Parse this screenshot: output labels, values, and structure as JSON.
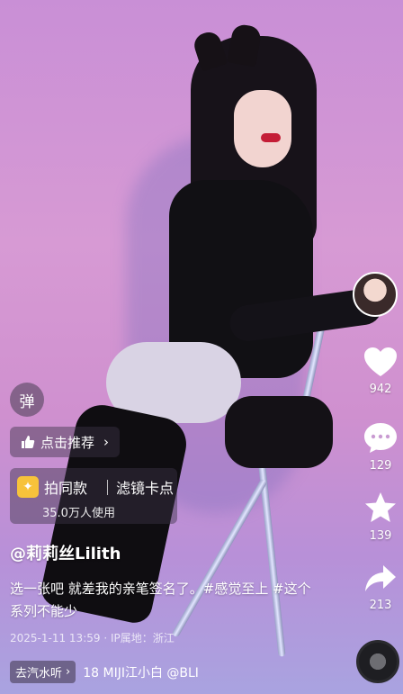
{
  "overlay": {
    "danmu_label": "弹",
    "recommend_label": "点击推荐",
    "recommend_arrow": "›",
    "template": {
      "title": "拍同款",
      "filter": "滤镜卡点",
      "users": "35.0万人使用"
    }
  },
  "post": {
    "author": "@莉莉丝Lilith",
    "caption": "选一张吧 就差我的亲笔签名了。#感觉至上 #这个系列不能少",
    "meta": "2025-1-11 13:59 · IP属地：浙江"
  },
  "music": {
    "chip_label": "去汽水听",
    "chip_arrow": "›",
    "title": "18 MIJI江小白 @BLI"
  },
  "actions": {
    "likes": "942",
    "comments": "129",
    "favorites": "139",
    "shares": "213"
  },
  "icons": {
    "like": "heart-icon",
    "comment": "comment-icon",
    "favorite": "star-icon",
    "share": "share-icon",
    "recommend": "thumbs-up-icon"
  }
}
